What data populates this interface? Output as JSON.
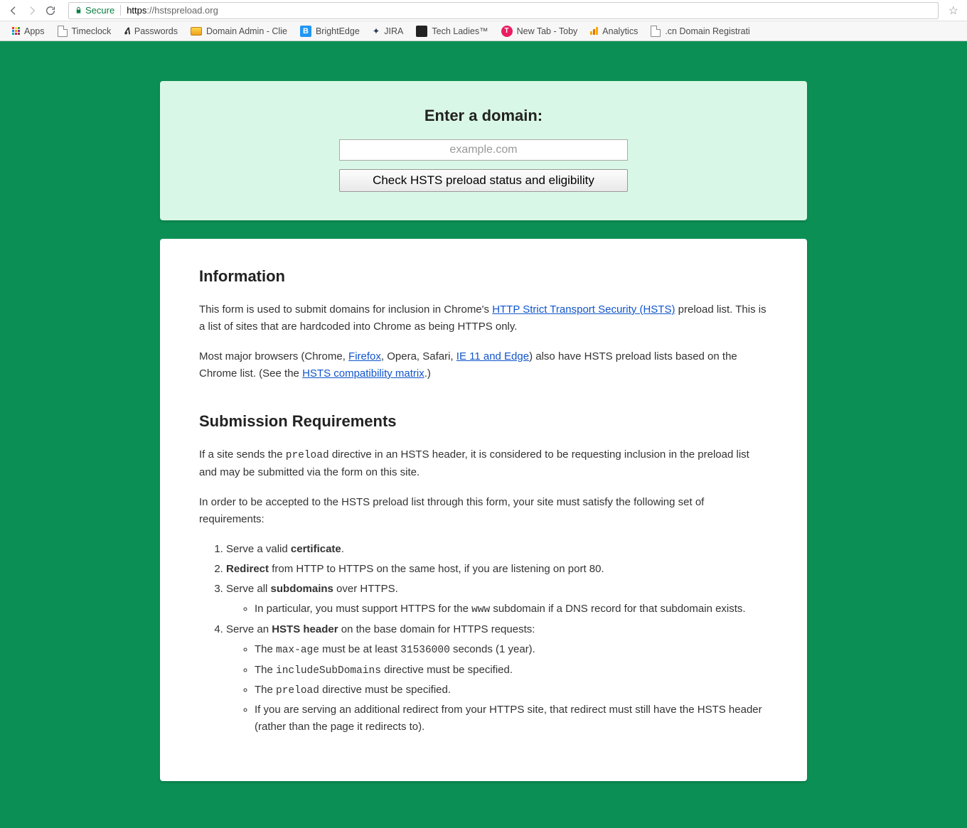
{
  "browser": {
    "secure_label": "Secure",
    "url_scheme": "https",
    "url_host": "://hstspreload.org",
    "bookmarks": [
      {
        "icon": "apps",
        "label": "Apps"
      },
      {
        "icon": "doc",
        "label": "Timeclock"
      },
      {
        "icon": "pw",
        "label": "Passwords"
      },
      {
        "icon": "da",
        "label": "Domain Admin - Clie"
      },
      {
        "icon": "be",
        "label": "BrightEdge"
      },
      {
        "icon": "jira",
        "label": "JIRA"
      },
      {
        "icon": "tl",
        "label": "Tech Ladies™"
      },
      {
        "icon": "toby",
        "label": "New Tab - Toby"
      },
      {
        "icon": "ga",
        "label": "Analytics"
      },
      {
        "icon": "doc",
        "label": ".cn Domain Registrati"
      }
    ]
  },
  "form": {
    "title": "Enter a domain:",
    "placeholder": "example.com",
    "button": "Check HSTS preload status and eligibility"
  },
  "content": {
    "info_h": "Information",
    "info_p1a": "This form is used to submit domains for inclusion in Chrome's ",
    "info_link1": "HTTP Strict Transport Security (HSTS)",
    "info_p1b": " preload list. This is a list of sites that are hardcoded into Chrome as being HTTPS only.",
    "info_p2a": "Most major browsers (Chrome, ",
    "info_link_firefox": "Firefox",
    "info_p2b": ", Opera, Safari, ",
    "info_link_ie": "IE 11 and Edge",
    "info_p2c": ") also have HSTS preload lists based on the Chrome list. (See the ",
    "info_link_matrix": "HSTS compatibility matrix",
    "info_p2d": ".)",
    "sub_h": "Submission Requirements",
    "sub_p1a": "If a site sends the ",
    "sub_code_preload": "preload",
    "sub_p1b": " directive in an HSTS header, it is considered to be requesting inclusion in the preload list and may be submitted via the form on this site.",
    "sub_p2": "In order to be accepted to the HSTS preload list through this form, your site must satisfy the following set of requirements:",
    "req": {
      "r1a": "Serve a valid ",
      "r1b": "certificate",
      "r1c": ".",
      "r2a": "Redirect",
      "r2b": " from HTTP to HTTPS on the same host, if you are listening on port 80.",
      "r3a": "Serve all ",
      "r3b": "subdomains",
      "r3c": " over HTTPS.",
      "r3_sub_a": "In particular, you must support HTTPS for the ",
      "r3_sub_code": "www",
      "r3_sub_b": " subdomain if a DNS record for that subdomain exists.",
      "r4a": "Serve an ",
      "r4b": "HSTS header",
      "r4c": " on the base domain for HTTPS requests:",
      "r4_s1a": "The ",
      "r4_s1code": "max-age",
      "r4_s1b": " must be at least ",
      "r4_s1code2": "31536000",
      "r4_s1c": " seconds (1 year).",
      "r4_s2a": "The ",
      "r4_s2code": "includeSubDomains",
      "r4_s2b": " directive must be specified.",
      "r4_s3a": "The ",
      "r4_s3code": "preload",
      "r4_s3b": " directive must be specified.",
      "r4_s4": "If you are serving an additional redirect from your HTTPS site, that redirect must still have the HSTS header (rather than the page it redirects to)."
    }
  }
}
